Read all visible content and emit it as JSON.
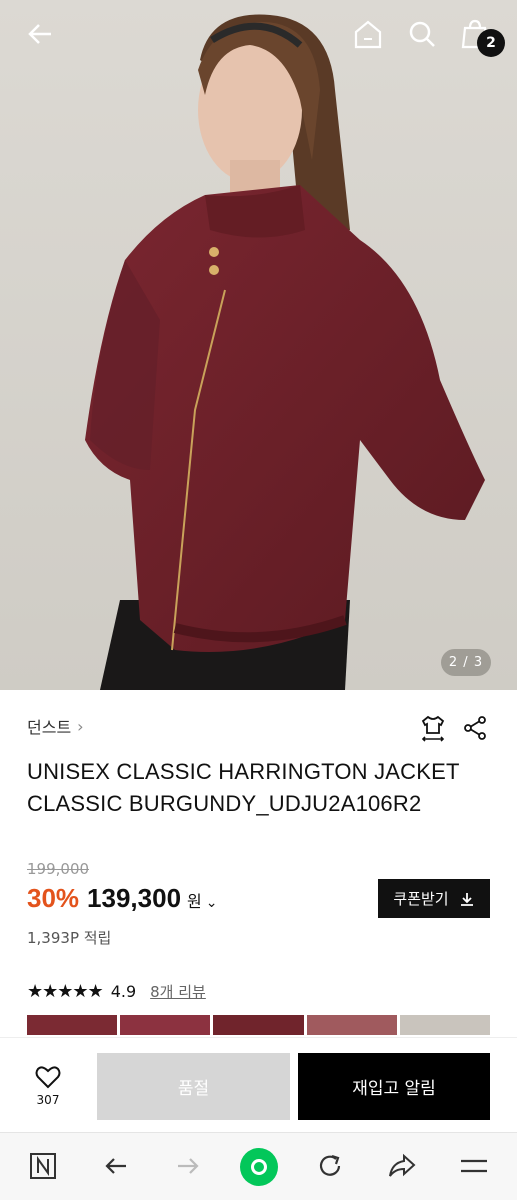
{
  "hero": {
    "pager": "2 / 3",
    "cart_count": "2",
    "icons": [
      "back-arrow-icon",
      "home-icon",
      "search-icon",
      "shopping-bag-icon"
    ]
  },
  "product": {
    "brand": "던스트",
    "title_line1": "UNISEX CLASSIC HARRINGTON JACKET",
    "title_line2": "CLASSIC BURGUNDY_UDJU2A106R2",
    "original_price": "199,000",
    "discount": "30%",
    "price": "139,300",
    "currency": "원",
    "points": "1,393P 적립",
    "coupon_label": "쿠폰받기",
    "rating_stars": "★★★★★",
    "rating_score": "4.9",
    "review_label": "8개 리뷰"
  },
  "actions": {
    "like_count": "307",
    "soldout_label": "품절",
    "restock_label": "재입고 알림"
  },
  "colors": {
    "accent_discount": "#e3531c",
    "jacket": "#6e1f26",
    "dark": "#111111"
  }
}
